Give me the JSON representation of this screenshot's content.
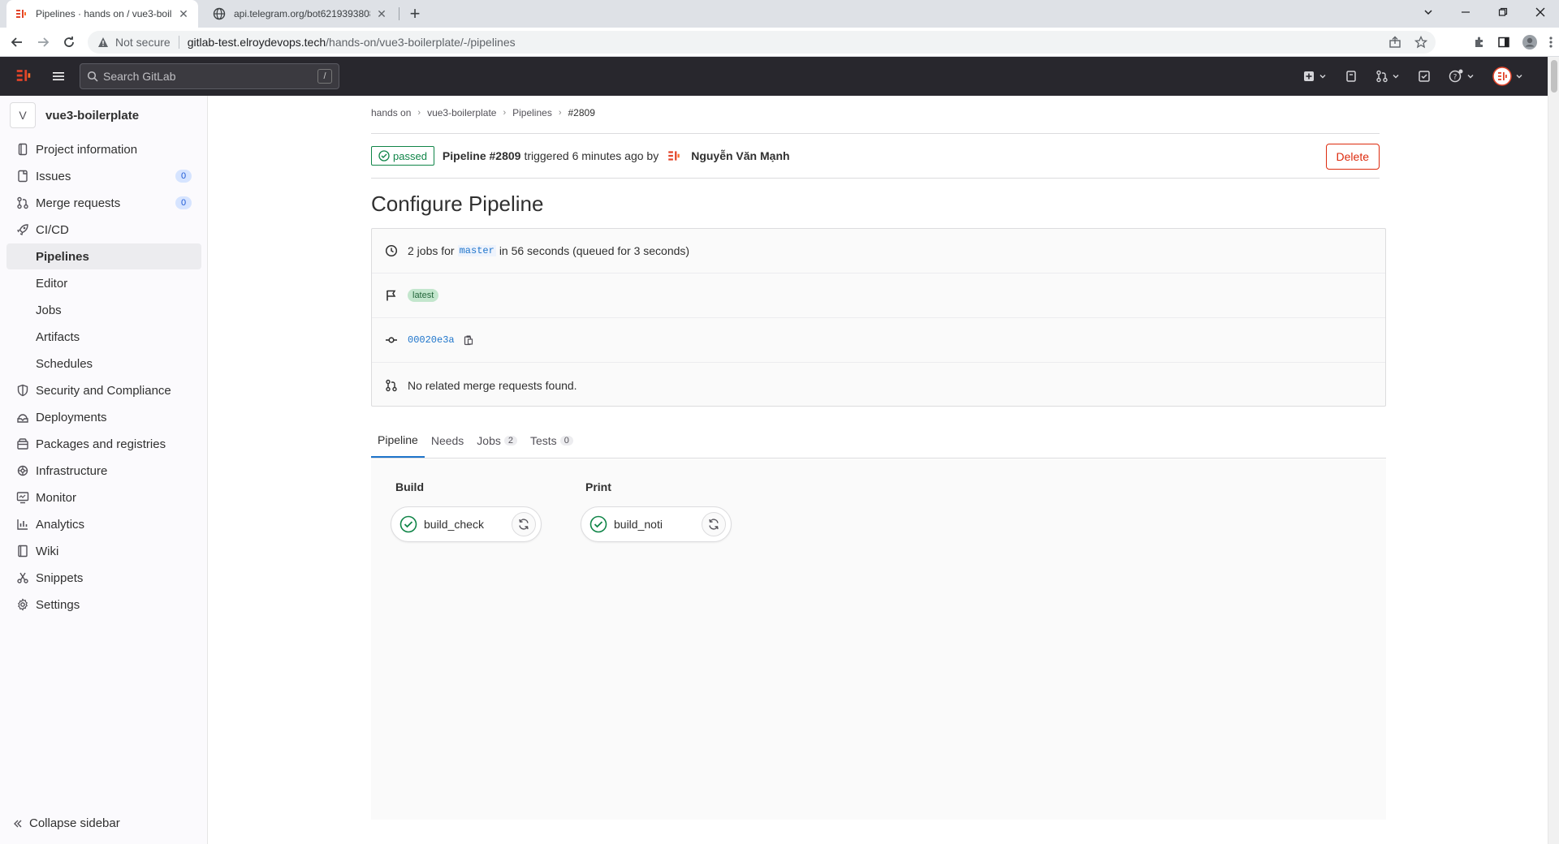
{
  "browser": {
    "tabs": [
      {
        "title": "Pipelines · hands on / vue3-boile",
        "active": true
      },
      {
        "title": "api.telegram.org/bot6219393808",
        "active": false
      }
    ],
    "address": {
      "security": "Not secure",
      "host": "gitlab-test.elroydevops.tech",
      "path": "/hands-on/vue3-boilerplate/-/pipelines"
    }
  },
  "gitlab": {
    "search_placeholder": "Search GitLab",
    "search_shortcut": "/"
  },
  "sidebar": {
    "project_initial": "V",
    "project_name": "vue3-boilerplate",
    "items": [
      {
        "label": "Project information",
        "icon": "project-icon"
      },
      {
        "label": "Issues",
        "icon": "issues-icon",
        "badge": "0"
      },
      {
        "label": "Merge requests",
        "icon": "merge-request-icon",
        "badge": "0"
      },
      {
        "label": "CI/CD",
        "icon": "rocket-icon"
      },
      {
        "label": "Pipelines",
        "sub": true,
        "active": true
      },
      {
        "label": "Editor",
        "sub": true
      },
      {
        "label": "Jobs",
        "sub": true
      },
      {
        "label": "Artifacts",
        "sub": true
      },
      {
        "label": "Schedules",
        "sub": true
      },
      {
        "label": "Security and Compliance",
        "icon": "shield-icon"
      },
      {
        "label": "Deployments",
        "icon": "deployments-icon"
      },
      {
        "label": "Packages and registries",
        "icon": "package-icon"
      },
      {
        "label": "Infrastructure",
        "icon": "cloud-icon"
      },
      {
        "label": "Monitor",
        "icon": "monitor-icon"
      },
      {
        "label": "Analytics",
        "icon": "chart-icon"
      },
      {
        "label": "Wiki",
        "icon": "book-icon"
      },
      {
        "label": "Snippets",
        "icon": "snippet-icon"
      },
      {
        "label": "Settings",
        "icon": "gear-icon"
      }
    ],
    "collapse_label": "Collapse sidebar"
  },
  "breadcrumb": [
    "hands on",
    "vue3-boilerplate",
    "Pipelines",
    "#2809"
  ],
  "pipeline": {
    "status": "passed",
    "name": "Pipeline #2809",
    "triggered_text": "triggered 6 minutes ago by",
    "user": "Nguyễn Văn Mạnh",
    "delete_label": "Delete",
    "title": "Configure Pipeline",
    "jobs_count_text": "2 jobs for",
    "branch": "master",
    "duration_text": "in 56 seconds (queued for 3 seconds)",
    "tag": "latest",
    "commit_sha": "00020e3a",
    "merge_requests_text": "No related merge requests found."
  },
  "tabs": [
    {
      "label": "Pipeline",
      "active": true
    },
    {
      "label": "Needs"
    },
    {
      "label": "Jobs",
      "count": "2"
    },
    {
      "label": "Tests",
      "count": "0"
    }
  ],
  "stages": [
    {
      "name": "Build",
      "jobs": [
        {
          "name": "build_check",
          "status": "success"
        }
      ]
    },
    {
      "name": "Print",
      "jobs": [
        {
          "name": "build_noti",
          "status": "success"
        }
      ]
    }
  ],
  "colors": {
    "success": "#108548",
    "danger": "#dd2b0e",
    "link": "#1f75cb",
    "topbar": "#28272d"
  }
}
